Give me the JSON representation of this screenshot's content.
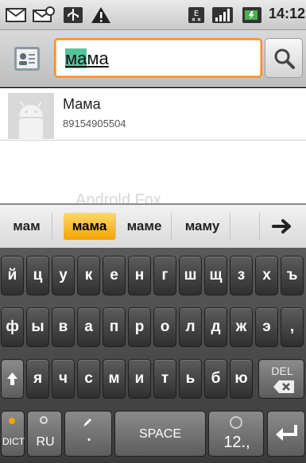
{
  "status_bar": {
    "time": "14:12",
    "icons": [
      "gmail-icon",
      "sms-icon",
      "usb-icon",
      "warning-icon",
      "sim-icon",
      "signal-icon",
      "battery-icon"
    ]
  },
  "search": {
    "query_highlight": "ма",
    "query_rest": "ма"
  },
  "results": [
    {
      "name": "Мама",
      "number": "89154905504"
    }
  ],
  "watermark": "Androld Fox",
  "suggestions": [
    "мам",
    "мама",
    "маме",
    "маму"
  ],
  "keyboard": {
    "row1": [
      "й",
      "ц",
      "у",
      "к",
      "е",
      "н",
      "г",
      "ш",
      "щ",
      "з",
      "х",
      "ъ"
    ],
    "row2": [
      "ф",
      "ы",
      "в",
      "а",
      "п",
      "р",
      "о",
      "л",
      "д",
      "ж",
      "э",
      ","
    ],
    "row3": [
      "я",
      "ч",
      "с",
      "м",
      "и",
      "т",
      "ь",
      "б",
      "ю"
    ],
    "del_label": "DEL",
    "dict_label": "DICT",
    "lang_label": "RU",
    "period_label": ".",
    "space_label": "SPACE",
    "numbers_label": "12.,"
  },
  "colors": {
    "accent": "#ff8e1c",
    "highlight": "#55c39b",
    "suggestion_selected": "#f4a400"
  }
}
